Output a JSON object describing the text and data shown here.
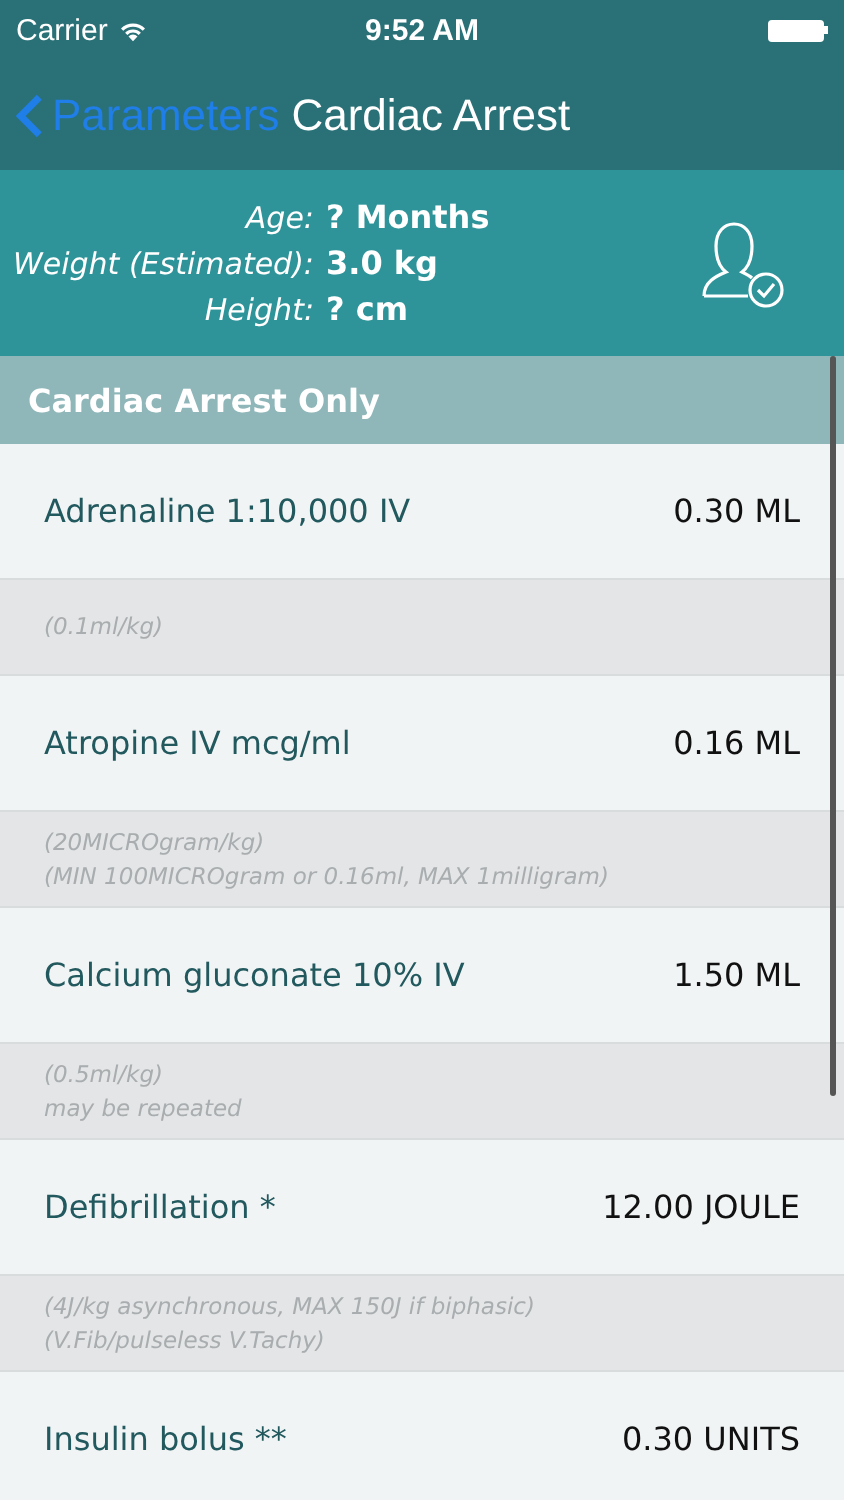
{
  "status_bar": {
    "carrier": "Carrier",
    "time": "9:52 AM"
  },
  "nav": {
    "back": "Parameters",
    "title": "Cardiac Arrest"
  },
  "patient": [
    {
      "label": "Age:",
      "value": "? Months"
    },
    {
      "label": "Weight (Estimated):",
      "value": "3.0 kg"
    },
    {
      "label": "Height:",
      "value": "? cm"
    }
  ],
  "section": "Cardiac Arrest Only",
  "drugs": [
    {
      "name": "Adrenaline 1:10,000 IV",
      "dose": "0.30 ML",
      "notes": [
        "(0.1ml/kg)"
      ]
    },
    {
      "name": "Atropine IV mcg/ml",
      "dose": "0.16 ML",
      "notes": [
        "(20MICROgram/kg)",
        "(MIN 100MICROgram or 0.16ml, MAX 1milligram)"
      ]
    },
    {
      "name": "Calcium gluconate 10% IV",
      "dose": "1.50 ML",
      "notes": [
        "(0.5ml/kg)",
        "may be repeated"
      ]
    },
    {
      "name": "Defibrillation *",
      "dose": "12.00 JOULE",
      "notes": [
        "(4J/kg asynchronous, MAX 150J if biphasic)",
        "(V.Fib/pulseless V.Tachy)"
      ]
    },
    {
      "name": "Insulin bolus **",
      "dose": "0.30 UNITS"
    }
  ]
}
